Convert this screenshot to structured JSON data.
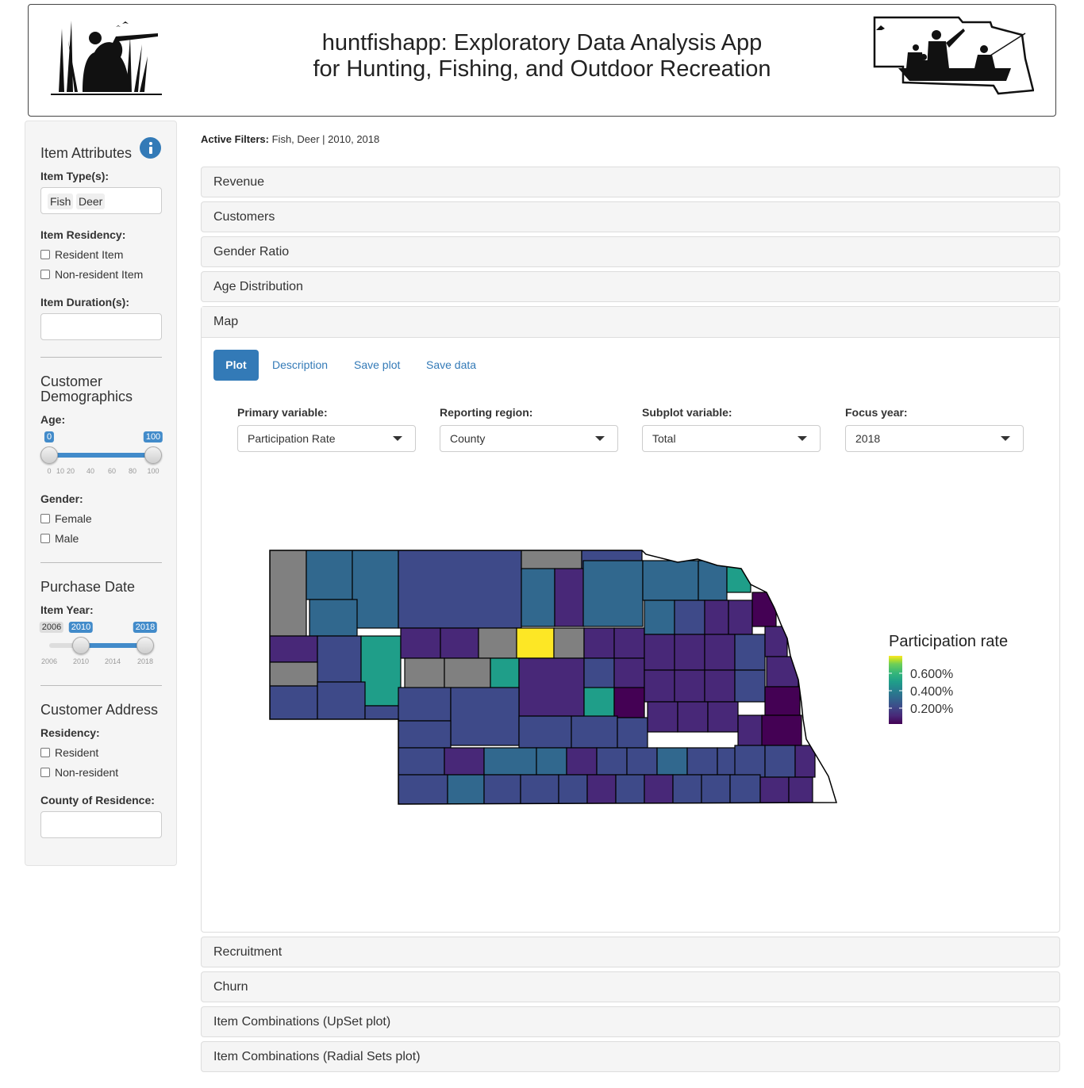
{
  "header": {
    "title_line1": "huntfishapp: Exploratory Data Analysis App",
    "title_line2": "for Hunting, Fishing, and Outdoor Recreation"
  },
  "sidebar": {
    "item_attributes": {
      "heading": "Item Attributes",
      "item_types_label": "Item Type(s):",
      "item_types": [
        "Fish",
        "Deer"
      ],
      "residency_label": "Item Residency:",
      "residency_options": [
        "Resident Item",
        "Non-resident Item"
      ],
      "duration_label": "Item Duration(s):"
    },
    "demographics": {
      "heading_line1": "Customer",
      "heading_line2": "Demographics",
      "age_label": "Age:",
      "age_min": "0",
      "age_max": "100",
      "age_range": [
        0,
        100
      ],
      "age_ticks": [
        "0",
        "10",
        "20",
        "40",
        "60",
        "80",
        "100"
      ],
      "gender_label": "Gender:",
      "gender_options": [
        "Female",
        "Male"
      ]
    },
    "purchase_date": {
      "heading": "Purchase Date",
      "year_label": "Item Year:",
      "min_badge": "2006",
      "from": "2010",
      "to": "2018",
      "year_range": [
        2010,
        2018
      ],
      "year_ticks": [
        "2006",
        "2010",
        "2014",
        "2018"
      ]
    },
    "address": {
      "heading": "Customer Address",
      "residency_label": "Residency:",
      "residency_options": [
        "Resident",
        "Non-resident"
      ],
      "county_label": "County of Residence:"
    }
  },
  "filters": {
    "label": "Active Filters:",
    "value": "Fish, Deer | 2010, 2018"
  },
  "panels": {
    "revenue": "Revenue",
    "customers": "Customers",
    "gender_ratio": "Gender Ratio",
    "age_distribution": "Age Distribution",
    "map": "Map",
    "recruitment": "Recruitment",
    "churn": "Churn",
    "upset": "Item Combinations (UpSet plot)",
    "radial": "Item Combinations (Radial Sets plot)"
  },
  "map_tabs": {
    "plot": "Plot",
    "description": "Description",
    "save_plot": "Save plot",
    "save_data": "Save data"
  },
  "controls": {
    "primary": {
      "label": "Primary variable:",
      "value": "Participation Rate"
    },
    "region": {
      "label": "Reporting region:",
      "value": "County"
    },
    "subplot": {
      "label": "Subplot variable:",
      "value": "Total"
    },
    "year": {
      "label": "Focus year:",
      "value": "2018"
    }
  },
  "legend": {
    "title": "Participation rate",
    "labels": [
      "0.600%",
      "0.400%",
      "0.200%"
    ]
  },
  "colors": {
    "accent": "#337ab7",
    "na_gray": "#808080",
    "viridis": [
      "#440154",
      "#482878",
      "#3e4a89",
      "#31688e",
      "#26828e",
      "#1f9e89",
      "#35b779",
      "#6ece58",
      "#b5de2b",
      "#fde725"
    ]
  }
}
